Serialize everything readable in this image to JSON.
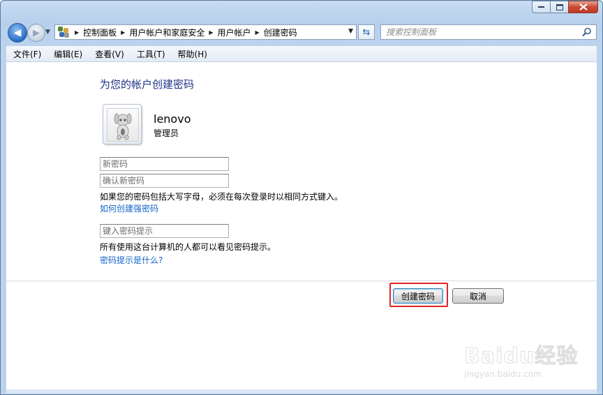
{
  "window": {
    "caption_buttons": [
      "minimize",
      "maximize",
      "close"
    ]
  },
  "navigation": {
    "breadcrumb": [
      "控制面板",
      "用户帐户和家庭安全",
      "用户帐户",
      "创建密码"
    ],
    "search_placeholder": "搜索控制面板"
  },
  "menu": [
    "文件(F)",
    "编辑(E)",
    "查看(V)",
    "工具(T)",
    "帮助(H)"
  ],
  "page": {
    "heading": "为您的帐户创建密码",
    "user": {
      "name": "lenovo",
      "role": "管理员"
    },
    "fields": {
      "new_password_placeholder": "新密码",
      "confirm_password_placeholder": "确认新密码",
      "hint_placeholder": "键入密码提示"
    },
    "case_note": "如果您的密码包括大写字母，必须在每次登录时以相同方式键入。",
    "strong_password_link": "如何创建强密码",
    "hint_note": "所有使用这台计算机的人都可以看见密码提示。",
    "hint_link": "密码提示是什么?"
  },
  "buttons": {
    "create": "创建密码",
    "cancel": "取消"
  },
  "watermark": {
    "brand": "Baidu经验",
    "url": "jingyan.baidu.com"
  },
  "colors": {
    "heading": "#1e3287",
    "link": "#1565c8",
    "highlight": "#e22222"
  }
}
